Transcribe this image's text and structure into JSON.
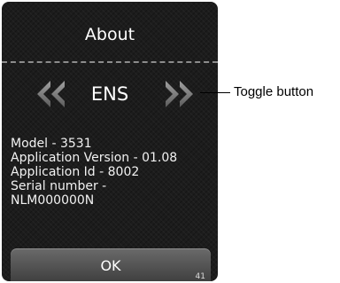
{
  "screen": {
    "title": "About",
    "language": "ENS",
    "prev_icon": "double-chevron-left-icon",
    "next_icon": "double-chevron-right-icon",
    "info": [
      "Model - 3531",
      "Application Version - 01.08",
      "Application Id - 8002",
      "Serial number -",
      "NLM000000N"
    ],
    "ok_label": "OK",
    "page_number": "41"
  },
  "annotation": {
    "label": "Toggle button"
  },
  "colors": {
    "background": "#1c1c1c",
    "text": "#ffffff",
    "arrow": "#8a8a8a",
    "button": "#555555"
  }
}
